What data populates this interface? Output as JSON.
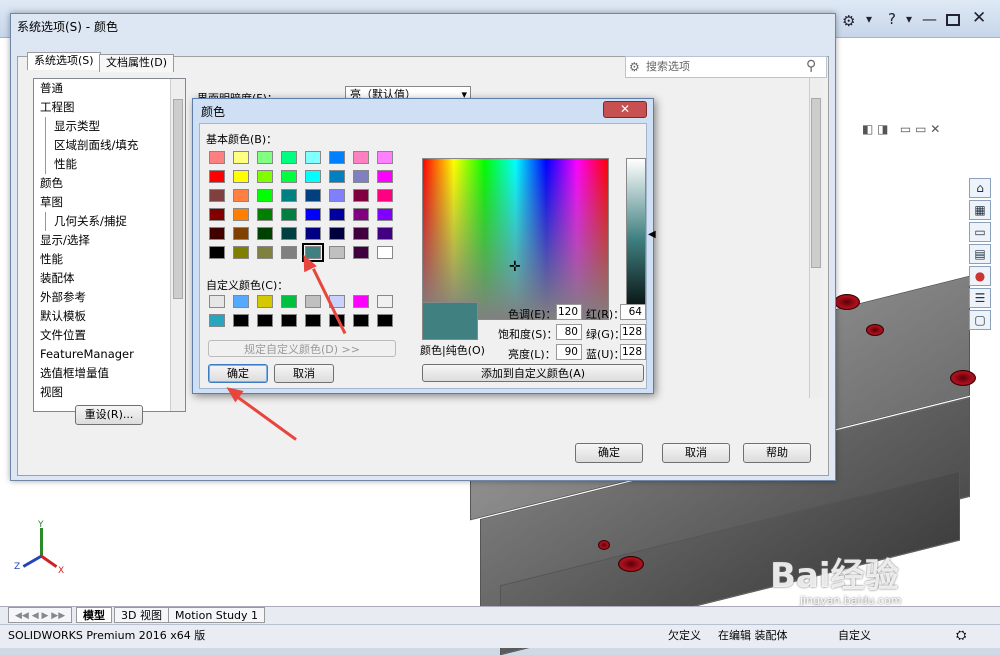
{
  "app": {
    "status_product": "SOLIDWORKS Premium 2016 x64 版",
    "status_under_defined": "欠定义",
    "status_editing": "在编辑 装配体",
    "status_custom": "自定义",
    "tabs": [
      "模型",
      "3D 视图",
      "Motion Study 1"
    ],
    "watermark": "Bai经验",
    "watermark_url": "jingyan.baidu.com"
  },
  "sys_dialog": {
    "title": "系统选项(S) - 颜色",
    "tab_system": "系统选项(S)",
    "tab_doc": "文档属性(D)",
    "search_placeholder": "搜索选项",
    "tree": [
      "普通",
      "工程图",
      "显示类型",
      "区域剖面线/填充",
      "性能",
      "颜色",
      "草图",
      "几何关系/捕捉",
      "显示/选择",
      "性能",
      "装配体",
      "外部参考",
      "默认模板",
      "文件位置",
      "FeatureManager",
      "选值框增量值",
      "视图"
    ],
    "brightness_label": "界面明暗度(F)：",
    "brightness_value": "亮（默认值）",
    "reset": "重设(R)...",
    "ok": "确定",
    "cancel": "取消",
    "help": "帮助"
  },
  "color_dialog": {
    "title": "颜色",
    "basic_label": "基本颜色(B)：",
    "custom_label": "自定义颜色(C)：",
    "define_custom": "规定自定义颜色(D) >>",
    "ok": "确定",
    "cancel": "取消",
    "preview_label": "颜色|纯色(O)",
    "add_custom": "添加到自定义颜色(A)",
    "hue_label": "色调(E)：",
    "hue": "120",
    "sat_label": "饱和度(S)：",
    "sat": "80",
    "lum_label": "亮度(L)：",
    "lum": "90",
    "red_label": "红(R)：",
    "red": "64",
    "green_label": "绿(G)：",
    "green": "128",
    "blue_label": "蓝(U)：",
    "blue": "128",
    "selected_color": "#408080",
    "basic_colors": [
      "#ff8080",
      "#ffff80",
      "#80ff80",
      "#00ff80",
      "#80ffff",
      "#0080ff",
      "#ff80c0",
      "#ff80ff",
      "#ff0000",
      "#ffff00",
      "#80ff00",
      "#00ff40",
      "#00ffff",
      "#0080c0",
      "#8080c0",
      "#ff00ff",
      "#804040",
      "#ff8040",
      "#00ff00",
      "#008080",
      "#004080",
      "#8080ff",
      "#800040",
      "#ff0080",
      "#800000",
      "#ff8000",
      "#008000",
      "#008040",
      "#0000ff",
      "#0000a0",
      "#800080",
      "#8000ff",
      "#400000",
      "#804000",
      "#004000",
      "#004040",
      "#000080",
      "#000040",
      "#400040",
      "#400080",
      "#000000",
      "#808000",
      "#808040",
      "#808080",
      "#408080",
      "#c0c0c0",
      "#400040",
      "#ffffff"
    ],
    "custom_colors": [
      "#e6e6e6",
      "#55aaff",
      "#d6c800",
      "#00c040",
      "#c0c0c0",
      "#c8d2ff",
      "#ff00ff",
      "#f0f0f0",
      "#2aa5c0",
      "#000000",
      "#000000",
      "#000000",
      "#000000",
      "#000000",
      "#000000",
      "#000000"
    ]
  }
}
